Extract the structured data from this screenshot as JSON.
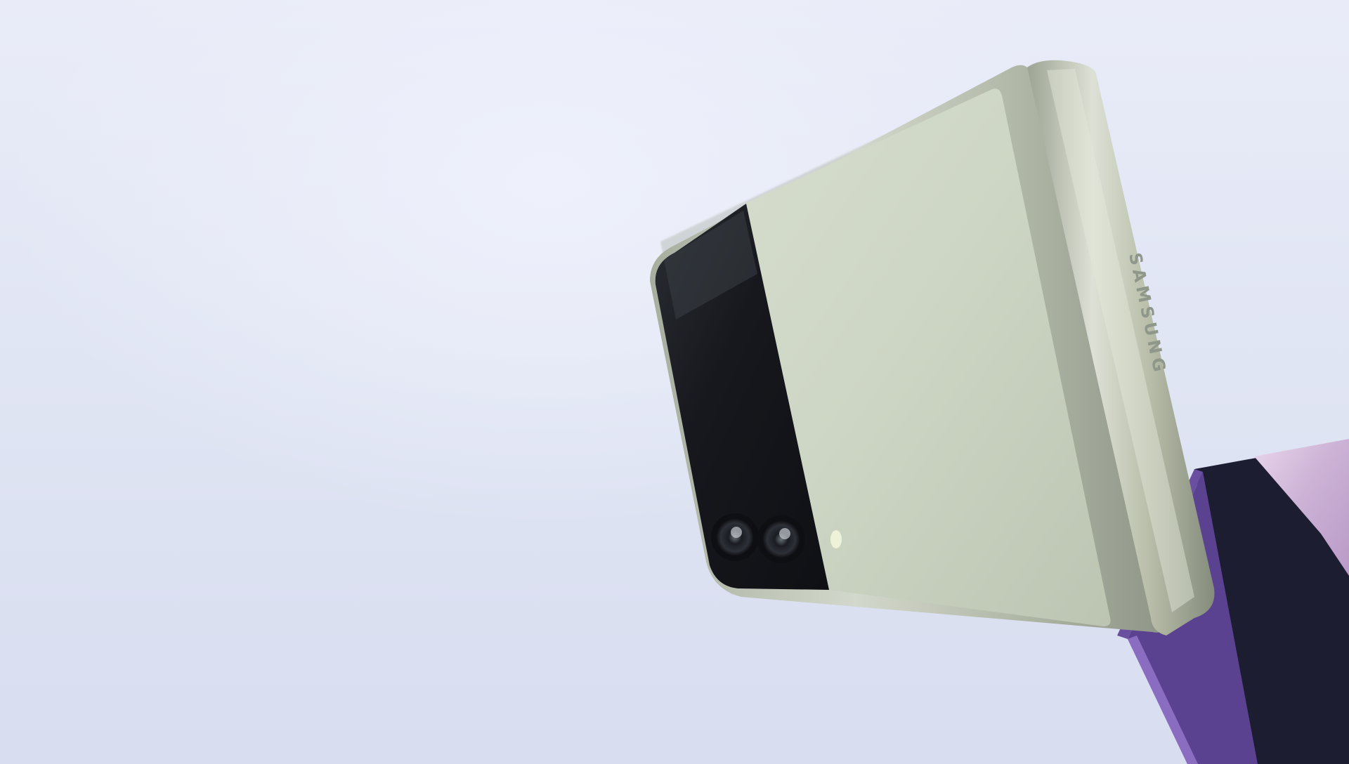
{
  "scene": {
    "description_label": "",
    "brand_wordmark": "SAMSUNG",
    "colors": {
      "background_top": "#e9ecf8",
      "background_bottom": "#d8ddf0",
      "phone_cover_green": "#c9d3c0",
      "phone_frame_silver": "#b9c0b0",
      "cover_screen_black": "#15171c",
      "second_phone_purple": "#6a4fa0",
      "second_phone_dark": "#1e1e33"
    }
  }
}
